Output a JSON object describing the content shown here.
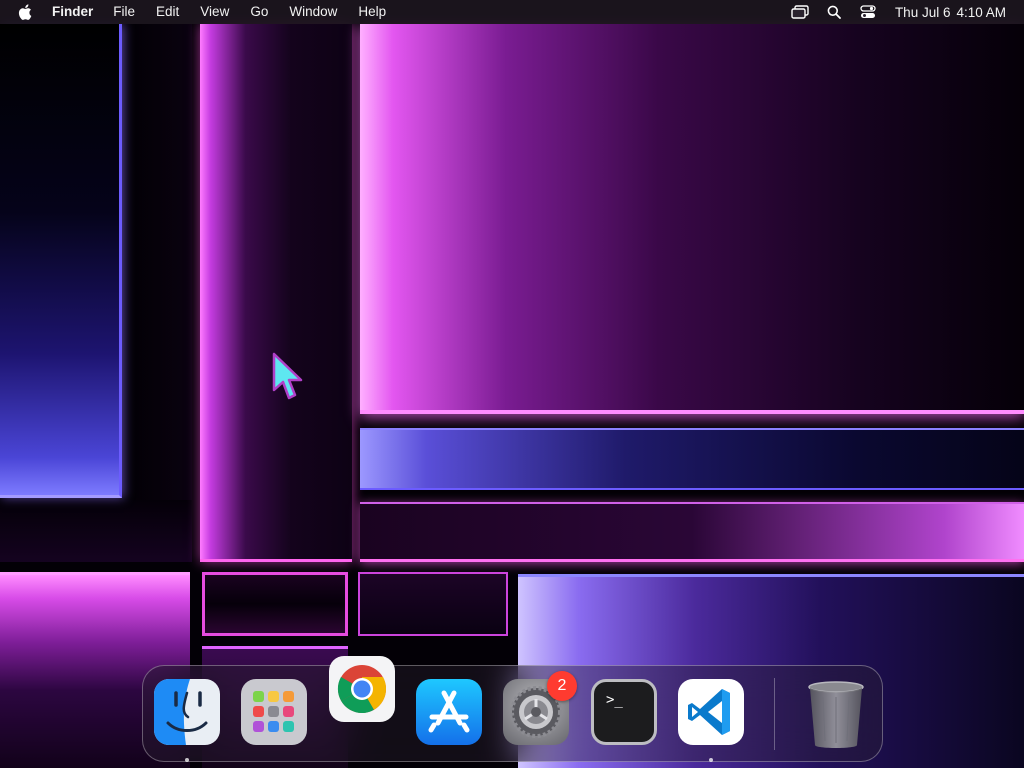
{
  "menubar": {
    "apple_icon": "apple-logo-icon",
    "app_name": "Finder",
    "menus": [
      "File",
      "Edit",
      "View",
      "Go",
      "Window",
      "Help"
    ],
    "status_icons": [
      "screen-mirroring-icon",
      "search-icon",
      "control-center-icon"
    ],
    "clock": {
      "date": "Thu Jul 6",
      "time": "4:10 AM"
    }
  },
  "dock": {
    "apps": [
      {
        "name": "Finder",
        "icon": "finder-icon",
        "running": true
      },
      {
        "name": "Launchpad",
        "icon": "launchpad-icon",
        "running": false
      },
      {
        "name": "Google Chrome",
        "icon": "chrome-icon",
        "running": false
      },
      {
        "name": "App Store",
        "icon": "app-store-icon",
        "running": false
      },
      {
        "name": "System Settings",
        "icon": "system-settings-icon",
        "running": false,
        "badge": "2"
      },
      {
        "name": "Terminal",
        "icon": "terminal-icon",
        "running": false,
        "prompt": ">_"
      },
      {
        "name": "Visual Studio Code",
        "icon": "vscode-icon",
        "running": true
      }
    ],
    "trash": {
      "name": "Trash",
      "icon": "trash-icon"
    }
  },
  "colors": {
    "badge": "#ff3b30",
    "cursor": "#5ee7f0",
    "finder_blue": "#1e8bf5",
    "vscode_blue": "#0a7acc"
  }
}
